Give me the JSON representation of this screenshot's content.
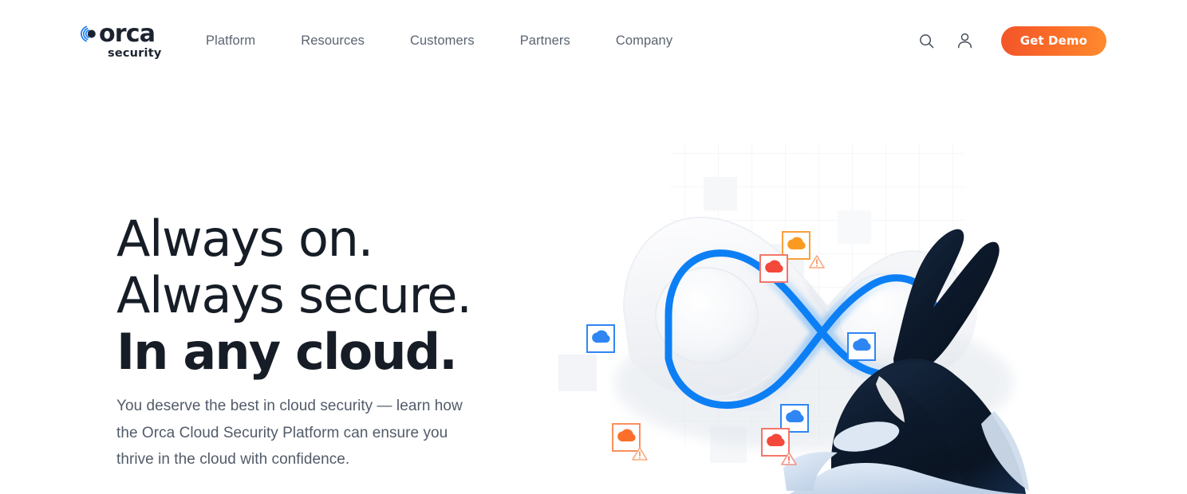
{
  "brand": {
    "logo_word": "orca",
    "logo_sub": "security",
    "logo_mark_icon": "orca-logo-mark-icon",
    "accent_orange": "#fa6a28",
    "accent_orange_dark": "#f2542a",
    "accent_orange_light": "#ff8b2e",
    "accent_blue": "#0d7ff5",
    "ink": "#161d26",
    "nav_text": "#5b6472"
  },
  "header": {
    "nav": [
      {
        "label": "Platform"
      },
      {
        "label": "Resources"
      },
      {
        "label": "Customers"
      },
      {
        "label": "Partners"
      },
      {
        "label": "Company"
      }
    ],
    "search_icon": "search-icon",
    "account_icon": "account-person-icon",
    "cta_label": "Get Demo"
  },
  "hero": {
    "headline": [
      {
        "text": "Always on.",
        "weight": "light"
      },
      {
        "text": "Always secure.",
        "weight": "light"
      },
      {
        "text": "In any cloud.",
        "weight": "bold"
      }
    ],
    "subtitle": "You deserve the best in cloud security — learn how the Orca Cloud Security Platform can ensure you thrive in the cloud with confidence."
  },
  "illustration": {
    "name": "orca-infinity-cloud-illustration",
    "infinity_line_color": "#0d7ff5",
    "whale_body_color": "#0d1b2e",
    "whale_belly_color": "#ccdcf0",
    "badges": [
      {
        "id": "badge-blue-left",
        "color": "#2f86f2",
        "cloud": "#2f86f2",
        "warning": false
      },
      {
        "id": "badge-blue-center",
        "color": "#2f86f2",
        "cloud": "#2f86f2",
        "warning": false
      },
      {
        "id": "badge-blue-lower",
        "color": "#2f86f2",
        "cloud": "#2f86f2",
        "warning": false
      },
      {
        "id": "badge-orange-top",
        "color": "#f9a03c",
        "cloud": "#fb9a20",
        "warning": true
      },
      {
        "id": "badge-red-top",
        "color": "#f4766a",
        "cloud": "#f4483a",
        "warning": false
      },
      {
        "id": "badge-orange-bottom",
        "color": "#f9905c",
        "cloud": "#fb6f2a",
        "warning": true
      },
      {
        "id": "badge-red-bottom",
        "color": "#f4766a",
        "cloud": "#f4483a",
        "warning": true
      }
    ]
  }
}
